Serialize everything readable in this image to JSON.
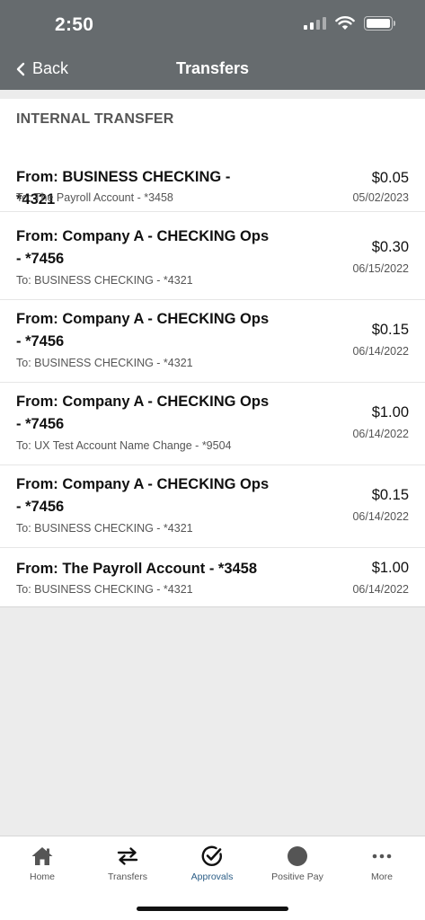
{
  "status_bar": {
    "time": "2:50"
  },
  "nav": {
    "back_label": "Back",
    "title": "Transfers"
  },
  "section": {
    "title": "INTERNAL TRANSFER"
  },
  "transfers": [
    {
      "from": "From: BUSINESS CHECKING - *4321",
      "to": "To: The Payroll Account - *3458",
      "amount": "$0.05",
      "date": "05/02/2023"
    },
    {
      "from": "From: Company A - CHECKING Ops - *7456",
      "to": "To: BUSINESS CHECKING - *4321",
      "amount": "$0.30",
      "date": "06/15/2022"
    },
    {
      "from": "From: Company A - CHECKING Ops - *7456",
      "to": "To: BUSINESS CHECKING - *4321",
      "amount": "$0.15",
      "date": "06/14/2022"
    },
    {
      "from": "From: Company A - CHECKING Ops - *7456",
      "to": "To: UX Test Account Name Change - *9504",
      "amount": "$1.00",
      "date": "06/14/2022"
    },
    {
      "from": "From: Company A - CHECKING Ops - *7456",
      "to": "To: BUSINESS CHECKING - *4321",
      "amount": "$0.15",
      "date": "06/14/2022"
    },
    {
      "from": "From: The Payroll Account - *3458",
      "to": "To: BUSINESS CHECKING - *4321",
      "amount": "$1.00",
      "date": "06/14/2022"
    }
  ],
  "tabs": [
    {
      "label": "Home",
      "icon": "home-icon"
    },
    {
      "label": "Transfers",
      "icon": "transfer-arrows-icon"
    },
    {
      "label": "Approvals",
      "icon": "check-circle-icon",
      "active": true
    },
    {
      "label": "Positive Pay",
      "icon": "circle-icon"
    },
    {
      "label": "More",
      "icon": "more-dots-icon"
    }
  ],
  "colors": {
    "header": "#666b6e",
    "active_tab": "#2b5d86",
    "background": "#ececec"
  }
}
